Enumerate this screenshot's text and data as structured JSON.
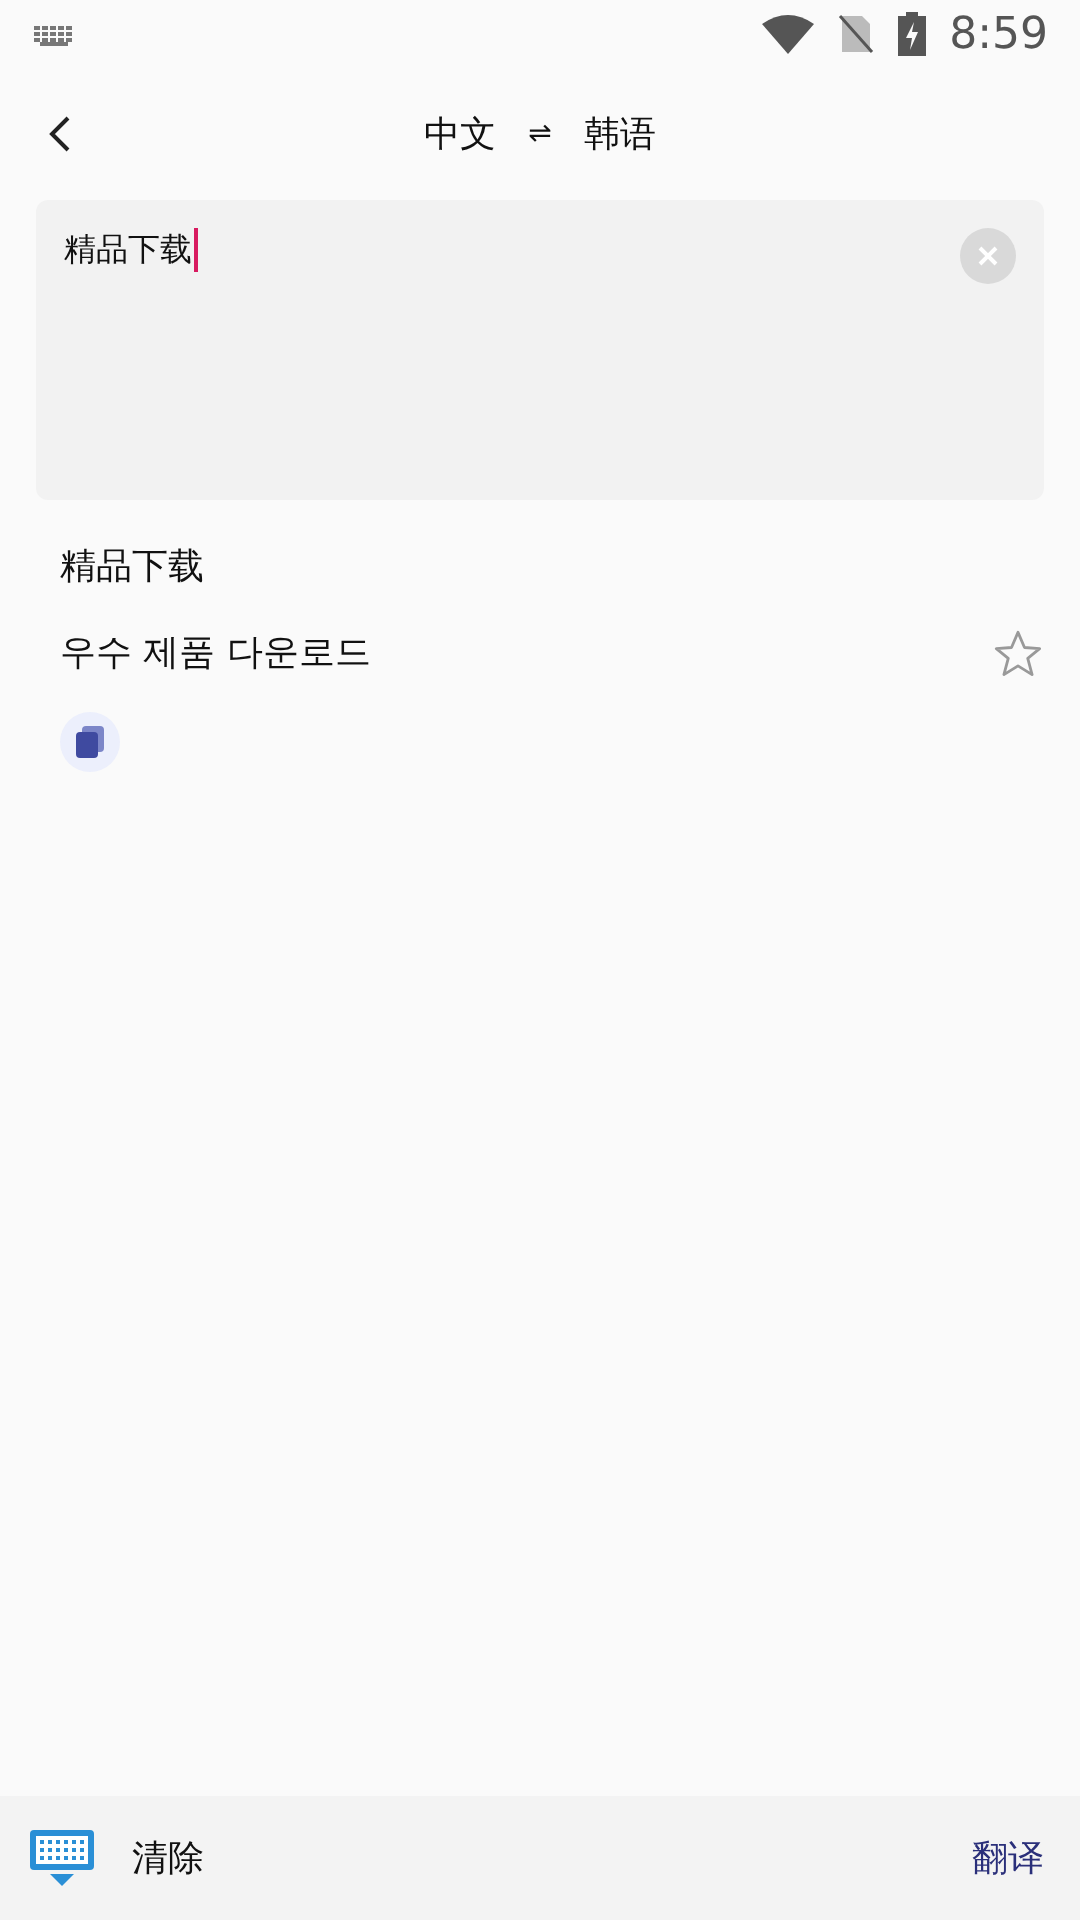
{
  "status_bar": {
    "time": "8:59"
  },
  "header": {
    "source_language": "中文",
    "swap": "⇌",
    "target_language": "韩语"
  },
  "input": {
    "value": "精品下载"
  },
  "result": {
    "source_text": "精品下载",
    "translation": "우수 제품 다운로드",
    "favorited": false
  },
  "bottom_bar": {
    "clear": "清除",
    "translate": "翻译"
  }
}
